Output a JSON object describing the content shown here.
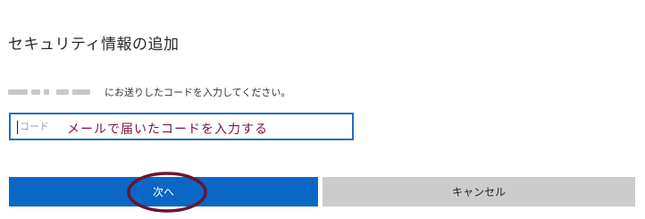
{
  "page": {
    "title": "セキュリティ情報の追加"
  },
  "description": {
    "text": "にお送りしたコードを入力してください。"
  },
  "code_field": {
    "placeholder": "コード",
    "annotation": "メールで届いたコードを入力する"
  },
  "buttons": {
    "next_label": "次へ",
    "cancel_label": "キャンセル"
  },
  "colors": {
    "primary": "#0a67c6",
    "secondary": "#cccccc",
    "annotation": "#7a1438"
  }
}
